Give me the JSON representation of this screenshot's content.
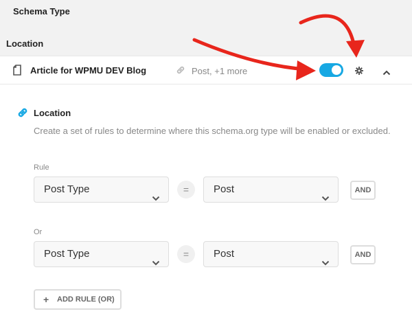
{
  "schema_type_title": "Schema Type",
  "location_title": "Location",
  "card": {
    "title": "Article for WPMU DEV Blog",
    "meta": "Post, +1 more",
    "toggle_on": true
  },
  "location_section": {
    "label": "Location",
    "description": "Create a set of rules to determine where this schema.org type will be enabled or excluded."
  },
  "rule_groups": [
    {
      "label": "Rule",
      "field": "Post Type",
      "operator": "=",
      "value": "Post",
      "and_label": "AND"
    },
    {
      "label": "Or",
      "field": "Post Type",
      "operator": "=",
      "value": "Post",
      "and_label": "AND"
    }
  ],
  "add_rule": {
    "plus": "+",
    "label": "ADD RULE (OR)"
  },
  "colors": {
    "accent": "#17a8e3",
    "annotation": "#e8261c"
  },
  "icons": [
    "document-icon",
    "link-icon",
    "toggle-switch",
    "gear-icon",
    "chevron-up-icon",
    "chevron-down-icon",
    "plus-icon"
  ]
}
